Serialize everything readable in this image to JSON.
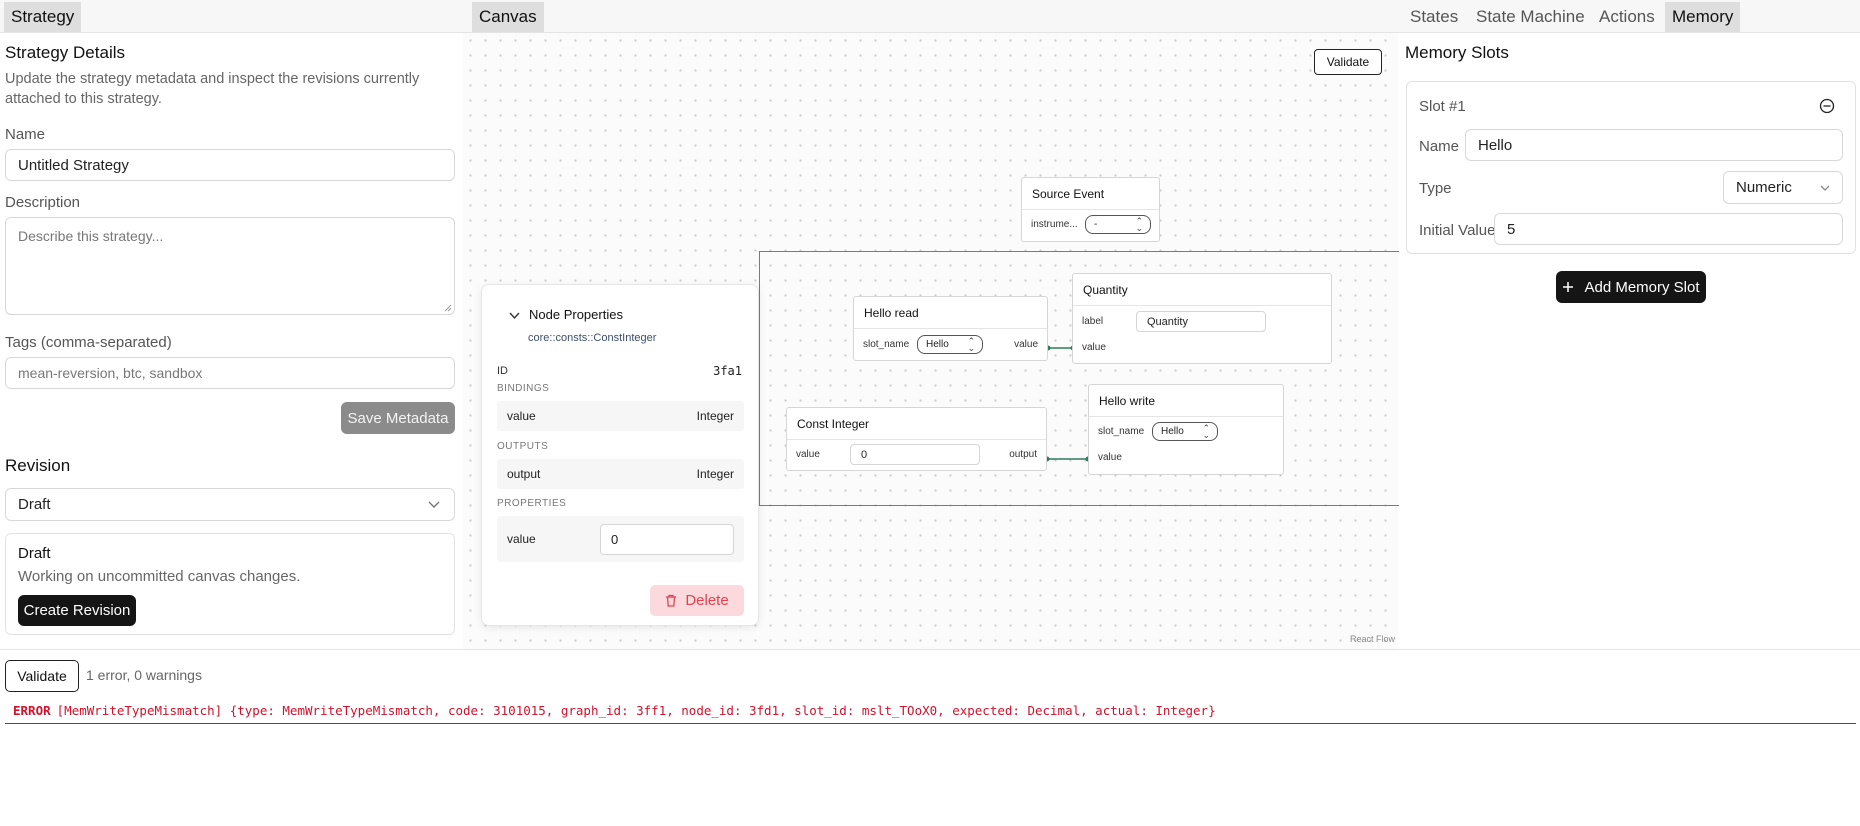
{
  "left_panel": {
    "tab": "Strategy",
    "heading": "Strategy Details",
    "description": "Update the strategy metadata and inspect the revisions currently attached to this strategy.",
    "name_label": "Name",
    "name_value": "Untitled Strategy",
    "desc_label": "Description",
    "desc_placeholder": "Describe this strategy...",
    "tags_label": "Tags (comma-separated)",
    "tags_placeholder": "mean-reversion, btc, sandbox",
    "save_button": "Save Metadata",
    "revision_heading": "Revision",
    "revision_selected": "Draft",
    "revision_card_title": "Draft",
    "revision_card_text": "Working on uncommitted canvas changes.",
    "create_revision_button": "Create Revision"
  },
  "canvas": {
    "tab": "Canvas",
    "validate_button": "Validate",
    "attribution": "React Flow",
    "nodes": {
      "source_event": {
        "title": "Source Event",
        "field_label": "instrume...",
        "field_value": "-"
      },
      "hello_read": {
        "title": "Hello read",
        "field_label": "slot_name",
        "field_value": "Hello",
        "output_label": "value"
      },
      "quantity": {
        "title": "Quantity",
        "label_label": "label",
        "label_value": "Quantity",
        "input_label": "value"
      },
      "const_integer": {
        "title": "Const Integer",
        "value_label": "value",
        "value_value": "0",
        "output_label": "output"
      },
      "hello_write": {
        "title": "Hello write",
        "field_label": "slot_name",
        "field_value": "Hello",
        "input_label": "value"
      }
    },
    "node_properties": {
      "title": "Node Properties",
      "type": "core::consts::ConstInteger",
      "id_label": "ID",
      "id_value": "3fa1",
      "bindings_heading": "BINDINGS",
      "binding_name": "value",
      "binding_type": "Integer",
      "outputs_heading": "OUTPUTS",
      "output_name": "output",
      "output_type": "Integer",
      "properties_heading": "PROPERTIES",
      "property_name": "value",
      "property_value": "0",
      "delete_button": "Delete"
    }
  },
  "right_panel": {
    "tabs": [
      "States",
      "State Machine",
      "Actions",
      "Memory"
    ],
    "active_tab": "Memory",
    "heading": "Memory Slots",
    "slot": {
      "title": "Slot #1",
      "name_label": "Name",
      "name_value": "Hello",
      "type_label": "Type",
      "type_value": "Numeric",
      "initial_label": "Initial Value",
      "initial_value": "5"
    },
    "add_button": "Add Memory Slot"
  },
  "bottom": {
    "validate_button": "Validate",
    "summary": "1 error, 0 warnings",
    "error_tag": "ERROR",
    "error_text": "[MemWriteTypeMismatch] {type: MemWriteTypeMismatch, code: 3101015, graph_id: 3ff1, node_id: 3fd1, slot_id: mslt_TOoX0, expected: Decimal, actual: Integer}"
  },
  "colors": {
    "edge": "#2e7d5b",
    "selection": "#4a7fe0",
    "error": "#d0122c",
    "delete_bg": "#fbd9dc",
    "delete_fg": "#e0434f"
  }
}
